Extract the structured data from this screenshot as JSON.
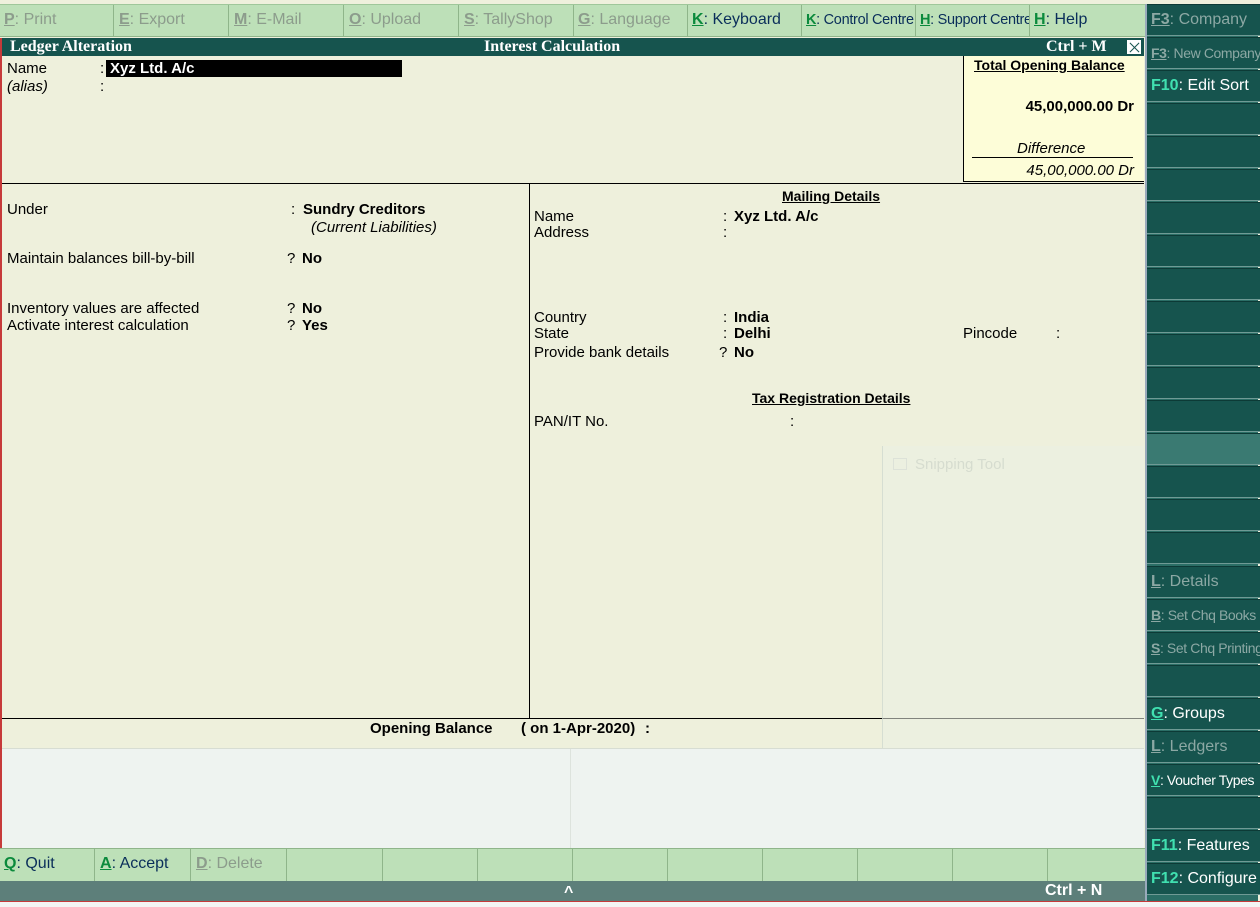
{
  "top_menu": [
    {
      "key": "P",
      "label": ": Print",
      "enabled": false
    },
    {
      "key": "E",
      "label": ": Export",
      "enabled": false
    },
    {
      "key": "M",
      "label": ": E-Mail",
      "enabled": false
    },
    {
      "key": "O",
      "label": ": Upload",
      "enabled": false
    },
    {
      "key": "S",
      "label": ": TallyShop",
      "enabled": false
    },
    {
      "key": "G",
      "label": ": Language",
      "enabled": false
    },
    {
      "key": "K",
      "label": ": Keyboard",
      "enabled": true
    },
    {
      "key": "K",
      "label": ": Control Centre",
      "enabled": true
    },
    {
      "key": "H",
      "label": ": Support Centre",
      "enabled": true
    },
    {
      "key": "H",
      "label": ": Help",
      "enabled": true
    }
  ],
  "title_bar": {
    "left": "Ledger Alteration",
    "center": "Interest Calculation",
    "shortcut": "Ctrl + M"
  },
  "ledger": {
    "name_label": "Name",
    "name_value": "Xyz Ltd. A/c",
    "alias_label": "(alias)",
    "sep": ":"
  },
  "balance_box": {
    "title": "Total Opening Balance",
    "amount": "45,00,000.00 Dr",
    "difference_label": "Difference",
    "difference_value": "45,00,000.00 Dr"
  },
  "left_panel": {
    "under_label": "Under",
    "under_value": "Sundry Creditors",
    "under_group": "(Current Liabilities)",
    "bill_label": "Maintain balances bill-by-bill",
    "bill_value": "No",
    "inventory_label": "Inventory values are affected",
    "inventory_value": "No",
    "interest_label": "Activate interest calculation",
    "interest_value": "Yes",
    "q": "?",
    "sep": ":"
  },
  "mailing": {
    "header": "Mailing Details",
    "name_label": "Name",
    "name_value": "Xyz Ltd. A/c",
    "address_label": "Address",
    "country_label": "Country",
    "country_value": "India",
    "state_label": "State",
    "state_value": "Delhi",
    "pincode_label": "Pincode",
    "bank_label": "Provide bank details",
    "bank_value": "No",
    "tax_header": "Tax Registration Details",
    "pan_label": "PAN/IT No."
  },
  "overlay": {
    "label": "Snipping Tool"
  },
  "opening": {
    "label": "Opening Balance",
    "date": "( on 1-Apr-2020)",
    "sep": ":"
  },
  "right_panel": [
    {
      "key": "F3",
      "label": ": Company",
      "enabled": false,
      "cond": false
    },
    {
      "key": "F3",
      "label": ": New Company",
      "enabled": false,
      "cond": true
    },
    {
      "key": "F10",
      "label": ": Edit Sort",
      "enabled": true,
      "cond": false
    },
    {
      "key": "L",
      "label": ": Details",
      "enabled": false,
      "cond": false
    },
    {
      "key": "B",
      "label": ": Set Chq Books",
      "enabled": false,
      "cond": true
    },
    {
      "key": "S",
      "label": ": Set Chq Printing",
      "enabled": false,
      "cond": true
    },
    {
      "key": "G",
      "label": ": Groups",
      "enabled": true,
      "cond": false
    },
    {
      "key": "L",
      "label": ": Ledgers",
      "enabled": false,
      "cond": false
    },
    {
      "key": "V",
      "label": ": Voucher Types",
      "enabled": true,
      "cond": true
    },
    {
      "key": "F11",
      "label": ": Features",
      "enabled": true,
      "cond": false
    },
    {
      "key": "F12",
      "label": ": Configure",
      "enabled": true,
      "cond": false
    }
  ],
  "bottom_menu": [
    {
      "key": "Q",
      "label": ": Quit",
      "enabled": true
    },
    {
      "key": "A",
      "label": ": Accept",
      "enabled": true
    },
    {
      "key": "D",
      "label": ": Delete",
      "enabled": false
    }
  ],
  "status_bar": {
    "caret": "^",
    "shortcut": "Ctrl + N"
  }
}
